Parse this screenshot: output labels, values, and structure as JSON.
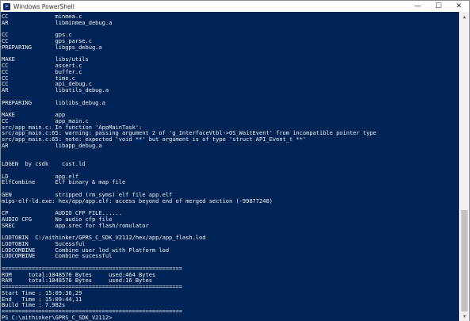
{
  "window": {
    "title": "Windows PowerShell",
    "icon_glyph": ">",
    "minimize_glyph": "—",
    "maximize_glyph": "☐",
    "close_glyph": "✕"
  },
  "console": {
    "lines": [
      "CC              minmea.c",
      "AR              libminmea_debug.a",
      "",
      "CC              gps.c",
      "CC              gps_parse.c",
      "PREPARING       libgps_debug.a",
      "",
      "MAKE            libs/utils",
      "CC              assert.c",
      "CC              buffer.c",
      "CC              time.c",
      "CC              api_debug.c",
      "AR              libutils_debug.a",
      "",
      "PREPARING       liblibs_debug.a",
      "",
      "MAKE            app",
      "CC              app_main.c",
      "src/app_main.c: In function 'AppMainTask':",
      "src/app_main.c:65: warning: passing argument 2 of 'g_InterfaceVtbl->OS_WaitEvent' from incompatible pointer type",
      "src/app_main.c:65: note: expected 'void **' but argument is of type 'struct API_Event_t **'",
      "AR              libapp_debug.a",
      "",
      "",
      "LDGEN  by csdk    cust.ld",
      "",
      "LD              app.elf",
      "ElfCombine      Elf binary & map file",
      "",
      "GEN             stripped (rm_syms) elf file app.elf",
      "mips-elf-ld.exe: hex/app/app.elf: access beyond end of merged section (-99877248)",
      "",
      "CP              AUDIO CFP FILE......",
      "AUDIO CFG       No audio cfp file",
      "SREC            app.srec for flash/romulator",
      "",
      "LODTOBIN  C:/aithinker/GPRS_C_SDK_V2112/hex/app/app_flash.lod",
      "LODTOBIN        Sucessful",
      "LODCOMBINE      Combine user lod with Platform lod",
      "LODCOMBINE      Combine sucessful",
      "",
      "======================================================",
      "ROM     total:1048576 Bytes     used:464 Bytes",
      "RAM     total:1048576 Bytes     used:16 Bytes",
      "======================================================",
      "Start Time : 15:09:36,29",
      "End   Time : 15:09:44,11",
      "Build Time : 7.982s",
      "======================================================",
      "PS C:\\aithinker\\GPRS_C_SDK_V2112>"
    ]
  },
  "scrollbar": {
    "up_glyph": "▲",
    "down_glyph": "▼",
    "position_fraction": 1.0,
    "visible_fraction": 0.35
  },
  "colors": {
    "console_bg": "#012456",
    "console_fg": "#eeedf0"
  }
}
